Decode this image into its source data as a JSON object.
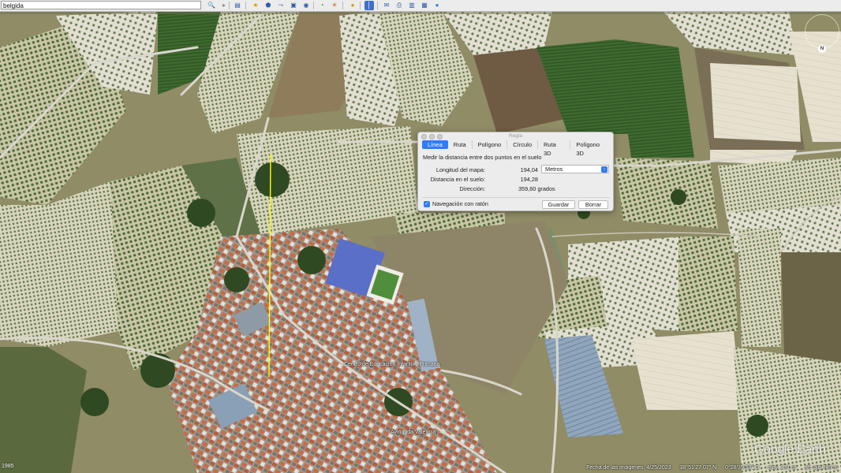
{
  "search": {
    "value": "belgida"
  },
  "dialog": {
    "title": "Regla",
    "tabs": [
      "Línea",
      "Ruta",
      "Polígono",
      "Círculo",
      "Ruta 3D",
      "Polígono 3D"
    ],
    "description": "Medir la distancia entre dos puntos en el suelo",
    "map_length_label": "Longitud del mapa:",
    "map_length_value": "194,04",
    "unit_selected": "Metros",
    "ground_distance_label": "Distancia en el suelo:",
    "ground_distance_value": "194,28",
    "heading_label": "Dirección:",
    "heading_value": "359,60 grados",
    "mouse_nav_label": "Navegación con ratón",
    "save_label": "Guardar",
    "clear_label": "Borrar"
  },
  "map_labels": {
    "school": "Centro de Educación Infantil y Primaria",
    "street": "Avinguda Valencia"
  },
  "status": {
    "imagery_date": "Fecha de las imágenes: 4/25/2023",
    "lat": "38°51'27.07\" N",
    "lon": "0°28'39.59\" O",
    "elev": "elev. 271 m",
    "alt": "alt. ojo 780 m"
  },
  "corner_year": "1985",
  "watermark": "Google Earth",
  "compass_letter": "N",
  "colors": {
    "accent": "#2f7cf6",
    "measure_line": "#ffff00"
  }
}
